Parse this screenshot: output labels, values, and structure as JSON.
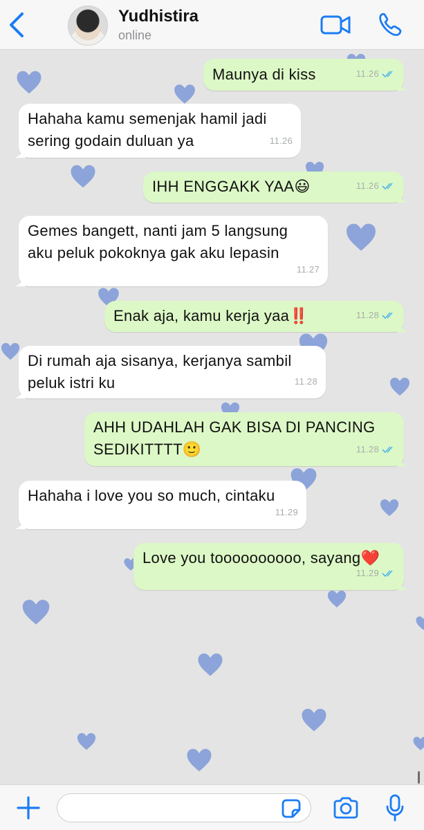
{
  "header": {
    "contact_name": "Yudhistira",
    "status": "online"
  },
  "messages": [
    {
      "direction": "out",
      "text": "Maunya di kiss",
      "time": "11.26",
      "read": true
    },
    {
      "direction": "in",
      "text": "Hahaha kamu semenjak hamil jadi\nsering godain duluan ya",
      "time": "11.26"
    },
    {
      "direction": "out",
      "text": "IHH ENGGAKK YAA",
      "emoji": "😃",
      "time": "11.26",
      "read": true
    },
    {
      "direction": "in",
      "text": "Gemes bangett, nanti jam 5 langsung\naku peluk pokoknya gak aku lepasin",
      "time": "11.27"
    },
    {
      "direction": "out",
      "text": "Enak aja, kamu kerja yaa",
      "emoji": "‼️",
      "time": "11.28",
      "read": true
    },
    {
      "direction": "in",
      "text": "Di rumah aja sisanya, kerjanya sambil\npeluk istri ku",
      "time": "11.28"
    },
    {
      "direction": "out",
      "text": "AHH UDAHLAH GAK BISA DI PANCING\nSEDIKITTTT",
      "emoji": "🙂",
      "time": "11.28",
      "read": true
    },
    {
      "direction": "in",
      "text": "Hahaha i love you so much, cintaku",
      "time": "11.29"
    },
    {
      "direction": "out",
      "text": "Love you toooooooooo, sayang",
      "emoji": "❤️",
      "time": "11.29",
      "read": true
    }
  ],
  "input": {
    "placeholder": ""
  },
  "colors": {
    "accent": "#1a7cf5",
    "outgoing_bubble": "#dcf8c6",
    "incoming_bubble": "#ffffff",
    "read_ticks": "#4fb6ec",
    "wallpaper_heart": "#6f8fd6"
  },
  "icons": [
    "back-chevron-icon",
    "video-camera-icon",
    "phone-icon",
    "plus-icon",
    "sticker-icon",
    "camera-icon",
    "microphone-icon",
    "double-check-icon",
    "heart-icon"
  ]
}
